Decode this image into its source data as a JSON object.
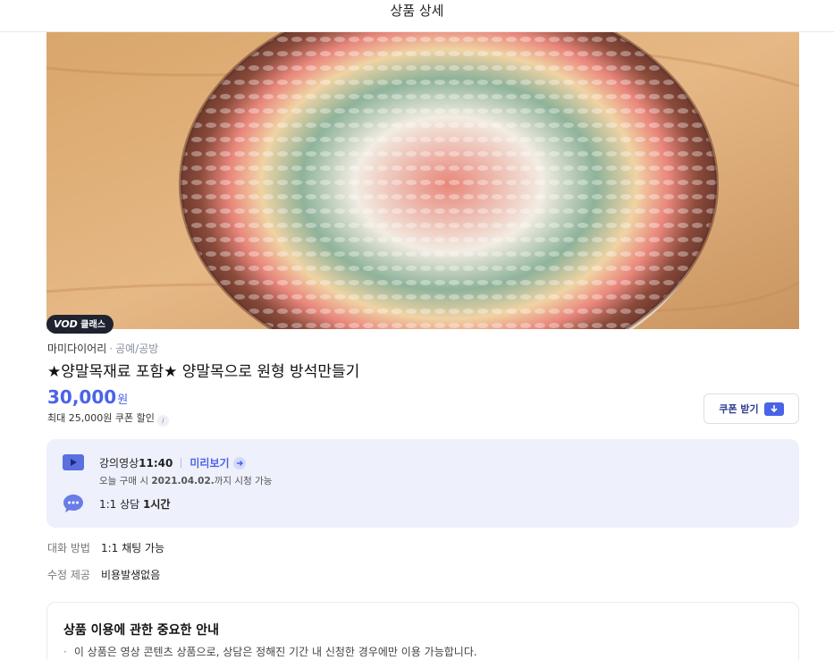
{
  "header": {
    "title": "상품 상세"
  },
  "hero": {
    "badge_vod": "VOD",
    "badge_text": "클래스"
  },
  "product": {
    "seller": "마미다이어리",
    "separator": "·",
    "category": "공예/공방",
    "title": "★양말목재료 포함★ 양말목으로 원형 방석만들기",
    "price": "30,000",
    "currency": "원",
    "discount_prefix": "최대 ",
    "discount_amount": "25,000원",
    "discount_suffix": " 쿠폰 할인",
    "info_icon_text": "i",
    "coupon_button": "쿠폰 받기"
  },
  "features": {
    "video_label": "강의영상 ",
    "video_duration": "11:40",
    "preview_link": "미리보기",
    "access_prefix": "오늘 구매 시 ",
    "access_date": "2021.04.02.",
    "access_suffix": "까지 시청 가능",
    "consult_prefix": "1:1 상담 ",
    "consult_duration": "1시간"
  },
  "details": [
    {
      "key": "대화 방법",
      "value": "1:1 채팅 가능"
    },
    {
      "key": "수정 제공",
      "value": "비용발생없음"
    }
  ],
  "notice": {
    "title": "상품 이용에 관한 중요한 안내",
    "bullet": "·",
    "items": [
      "이 상품은 영상 콘텐츠 상품으로, 상담은 정해진 기간 내 신청한 경우에만 이용 가능합니다."
    ]
  },
  "icons": {
    "play": "play-icon",
    "chat": "chat-bubble-icon",
    "coupon": "download-arrow-icon",
    "preview_arrow": "arrow-right-icon",
    "info": "info-icon"
  },
  "colors": {
    "accent": "#4a63e7",
    "feature_bg": "#eef0fb",
    "badge_bg": "#1f2330"
  }
}
